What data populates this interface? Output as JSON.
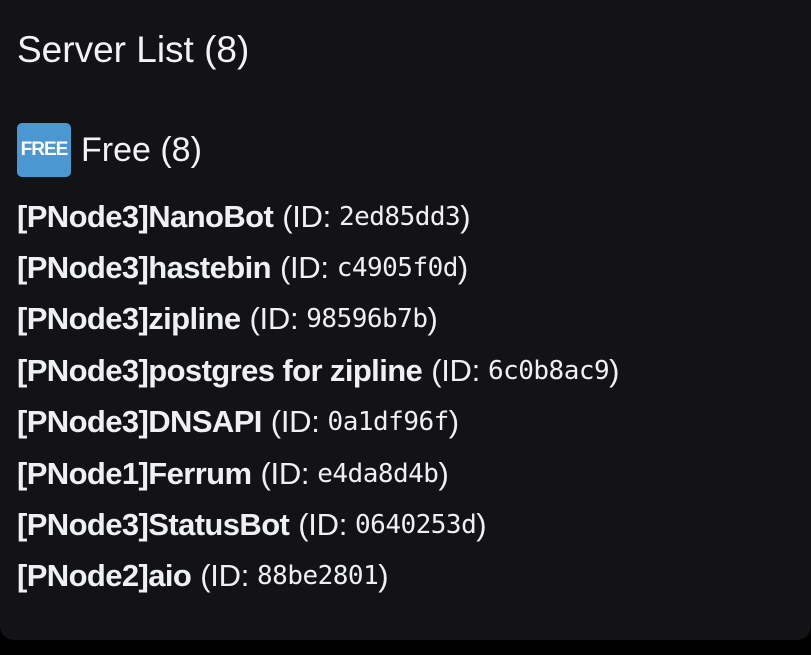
{
  "header": {
    "title": "Server List (8)"
  },
  "section": {
    "badge_label": "FREE",
    "title": "Free (8)"
  },
  "id_prefix": "(ID:",
  "id_suffix": ")",
  "servers": [
    {
      "name": "[PNode3]NanoBot",
      "id": "2ed85dd3"
    },
    {
      "name": "[PNode3]hastebin",
      "id": "c4905f0d"
    },
    {
      "name": "[PNode3]zipline",
      "id": "98596b7b"
    },
    {
      "name": "[PNode3]postgres for zipline",
      "id": "6c0b8ac9"
    },
    {
      "name": "[PNode3]DNSAPI",
      "id": "0a1df96f"
    },
    {
      "name": "[PNode1]Ferrum",
      "id": "e4da8d4b"
    },
    {
      "name": "[PNode3]StatusBot",
      "id": "0640253d"
    },
    {
      "name": "[PNode2]aio",
      "id": "88be2801"
    }
  ],
  "colors": {
    "background": "#000000",
    "card": "#131316",
    "text": "#f2f3f5",
    "free_badge": "#4a97d2"
  },
  "icons": {
    "badge": "free-button-emoji-icon"
  }
}
